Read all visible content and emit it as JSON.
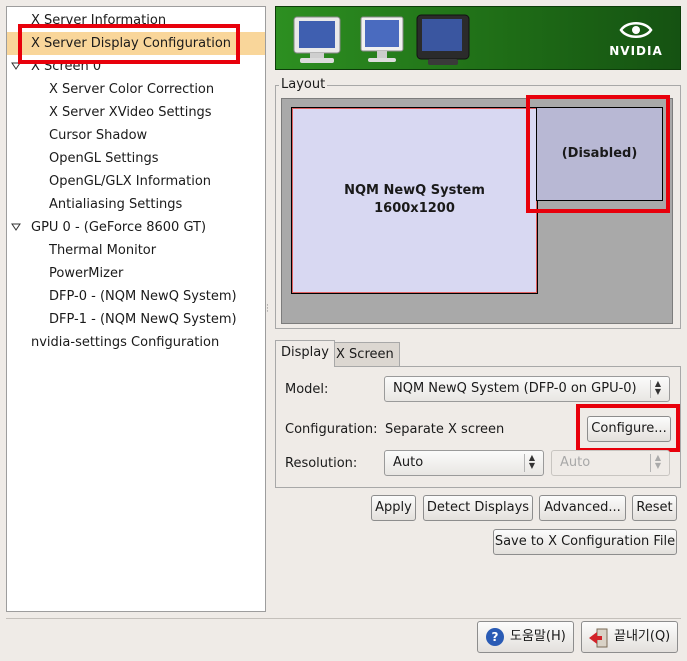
{
  "tree": {
    "items": [
      {
        "label": "X Server Information",
        "level": 1,
        "selected": false
      },
      {
        "label": "X Server Display Configuration",
        "level": 1,
        "selected": true
      },
      {
        "label": "X Screen 0",
        "level": 1,
        "expander": true
      },
      {
        "label": "X Server Color Correction",
        "level": 2
      },
      {
        "label": "X Server XVideo Settings",
        "level": 2
      },
      {
        "label": "Cursor Shadow",
        "level": 2
      },
      {
        "label": "OpenGL Settings",
        "level": 2
      },
      {
        "label": "OpenGL/GLX Information",
        "level": 2
      },
      {
        "label": "Antialiasing Settings",
        "level": 2
      },
      {
        "label": "GPU 0 - (GeForce 8600 GT)",
        "level": 1,
        "expander": true
      },
      {
        "label": "Thermal Monitor",
        "level": 2
      },
      {
        "label": "PowerMizer",
        "level": 2
      },
      {
        "label": "DFP-0 - (NQM NewQ System)",
        "level": 2
      },
      {
        "label": "DFP-1 - (NQM NewQ System)",
        "level": 2
      },
      {
        "label": "nvidia-settings Configuration",
        "level": 1
      }
    ]
  },
  "banner": {
    "brand": "NVIDIA"
  },
  "layout": {
    "label": "Layout",
    "display_a": {
      "name": "NQM NewQ System",
      "resolution": "1600x1200"
    },
    "display_b": {
      "status": "(Disabled)"
    }
  },
  "tabs": [
    {
      "label": "Display",
      "active": true
    },
    {
      "label": "X Screen",
      "active": false
    }
  ],
  "display_tab": {
    "model_label": "Model:",
    "model_value": "NQM NewQ System (DFP-0 on GPU-0)",
    "configuration_label": "Configuration:",
    "configuration_value": "Separate X screen",
    "configure_button": "Configure...",
    "resolution_label": "Resolution:",
    "resolution_value": "Auto",
    "refresh_value": "Auto"
  },
  "actions": {
    "apply": "Apply",
    "detect": "Detect Displays",
    "advanced": "Advanced...",
    "reset": "Reset",
    "save": "Save to X Configuration File"
  },
  "footer": {
    "help": "도움말(H)",
    "quit": "끝내기(Q)"
  },
  "colors": {
    "highlight": "#e8000b",
    "selected_row": "#f9d69a",
    "banner_green": "#2d8f21"
  }
}
